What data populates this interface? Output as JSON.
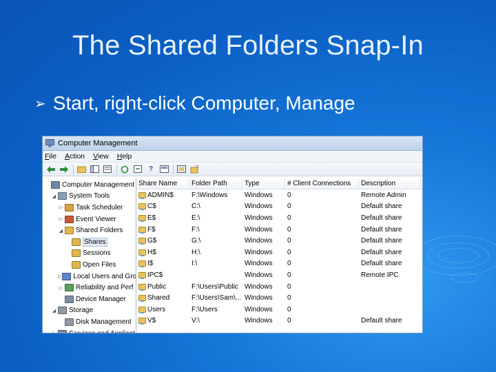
{
  "slide": {
    "title": "The Shared Folders Snap-In",
    "bullet": "Start, right-click Computer, Manage"
  },
  "window": {
    "title": "Computer Management",
    "menu": [
      "File",
      "Action",
      "View",
      "Help"
    ],
    "tree": [
      {
        "label": "Computer Management",
        "indent": 0,
        "exp": "",
        "color": "#6f87a6"
      },
      {
        "label": "System Tools",
        "indent": 1,
        "exp": "◢",
        "color": "#8aa0b8"
      },
      {
        "label": "Task Scheduler",
        "indent": 2,
        "exp": "▷",
        "color": "#d9a441"
      },
      {
        "label": "Event Viewer",
        "indent": 2,
        "exp": "▷",
        "color": "#c85a3a"
      },
      {
        "label": "Shared Folders",
        "indent": 2,
        "exp": "◢",
        "color": "#e0b84a"
      },
      {
        "label": "Shares",
        "indent": 3,
        "exp": "",
        "color": "#e0b84a",
        "selected": true
      },
      {
        "label": "Sessions",
        "indent": 3,
        "exp": "",
        "color": "#e0b84a"
      },
      {
        "label": "Open Files",
        "indent": 3,
        "exp": "",
        "color": "#e0b84a"
      },
      {
        "label": "Local Users and Gro",
        "indent": 2,
        "exp": "▷",
        "color": "#5d88c7"
      },
      {
        "label": "Reliability and Perf",
        "indent": 2,
        "exp": "▷",
        "color": "#5aa05a"
      },
      {
        "label": "Device Manager",
        "indent": 2,
        "exp": "",
        "color": "#7d8fa4"
      },
      {
        "label": "Storage",
        "indent": 1,
        "exp": "◢",
        "color": "#8f9aa6"
      },
      {
        "label": "Disk Management",
        "indent": 2,
        "exp": "",
        "color": "#8f9aa6"
      },
      {
        "label": "Services and Applicat",
        "indent": 1,
        "exp": "▷",
        "color": "#7a8aa0"
      }
    ],
    "columns": [
      "Share Name",
      "Folder Path",
      "Type",
      "# Client Connections",
      "Description"
    ],
    "rows": [
      [
        "ADMIN$",
        "F:\\Windows",
        "Windows",
        "0",
        "Remote Admin"
      ],
      [
        "C$",
        "C:\\",
        "Windows",
        "0",
        "Default share"
      ],
      [
        "E$",
        "E:\\",
        "Windows",
        "0",
        "Default share"
      ],
      [
        "F$",
        "F:\\",
        "Windows",
        "0",
        "Default share"
      ],
      [
        "G$",
        "G:\\",
        "Windows",
        "0",
        "Default share"
      ],
      [
        "H$",
        "H:\\",
        "Windows",
        "0",
        "Default share"
      ],
      [
        "I$",
        "I:\\",
        "Windows",
        "0",
        "Default share"
      ],
      [
        "IPC$",
        "",
        "Windows",
        "0",
        "Remote IPC"
      ],
      [
        "Public",
        "F:\\Users\\Public",
        "Windows",
        "0",
        ""
      ],
      [
        "Shared",
        "F:\\Users\\Sam\\...",
        "Windows",
        "0",
        ""
      ],
      [
        "Users",
        "F:\\Users",
        "Windows",
        "0",
        ""
      ],
      [
        "V$",
        "V:\\",
        "Windows",
        "0",
        "Default share"
      ]
    ]
  }
}
